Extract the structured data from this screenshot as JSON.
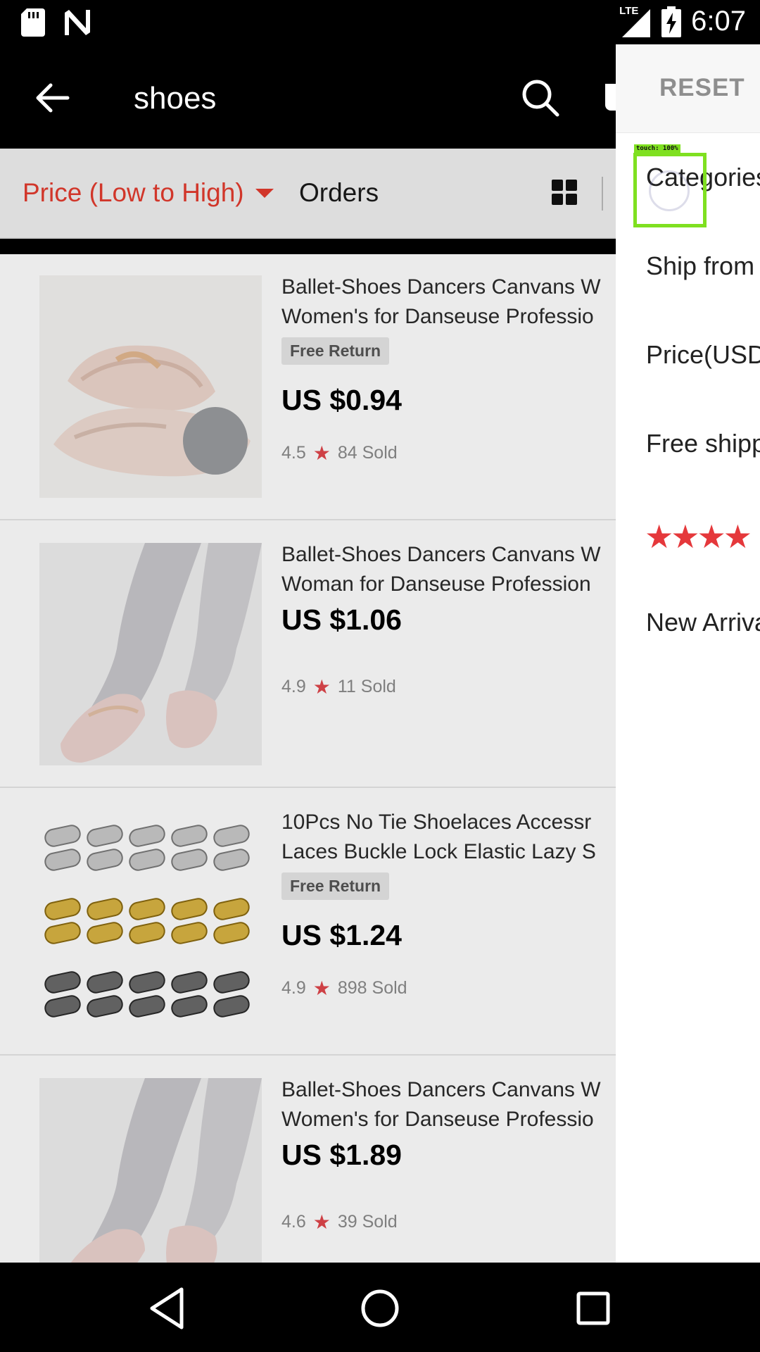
{
  "status_bar": {
    "time": "6:07",
    "network": "LTE",
    "icons": [
      "sd-card-icon",
      "n-notification-icon",
      "signal-icon",
      "battery-charging-icon"
    ]
  },
  "app_bar": {
    "title": "shoes",
    "icons": [
      "back-arrow-icon",
      "search-icon",
      "cart-icon"
    ]
  },
  "sort_bar": {
    "price_sort_label": "Price (Low to High)",
    "orders_label": "Orders"
  },
  "products": [
    {
      "name_line1": "Ballet-Shoes Dancers Canvans W",
      "name_line2": "Women's for Danseuse Professio",
      "badge": "Free Return",
      "price": "US $0.94",
      "rating": "4.5",
      "sold": "84 Sold"
    },
    {
      "name_line1": "Ballet-Shoes Dancers Canvans W",
      "name_line2": "Woman for Danseuse Profession",
      "badge": "",
      "price": "US $1.06",
      "rating": "4.9",
      "sold": "11 Sold"
    },
    {
      "name_line1": "10Pcs No Tie Shoelaces Accessr",
      "name_line2": "Laces Buckle Lock Elastic Lazy S",
      "badge": "Free Return",
      "price": "US $1.24",
      "rating": "4.9",
      "sold": "898 Sold"
    },
    {
      "name_line1": "Ballet-Shoes Dancers Canvans W",
      "name_line2": "Women's for Danseuse Professio",
      "badge": "",
      "price": "US $1.89",
      "rating": "4.6",
      "sold": "39 Sold"
    }
  ],
  "filter_drawer": {
    "reset_label": "RESET",
    "rows": [
      "Categories",
      "Ship from",
      "Price(USD",
      "Free shipp",
      "New Arriva"
    ],
    "stars": "★★★★"
  },
  "touch_overlay": {
    "label": "touch: 100%"
  },
  "colors": {
    "accent_red": "#e33b2e",
    "star_red": "#e0464b",
    "touch_green": "#7fe020"
  }
}
